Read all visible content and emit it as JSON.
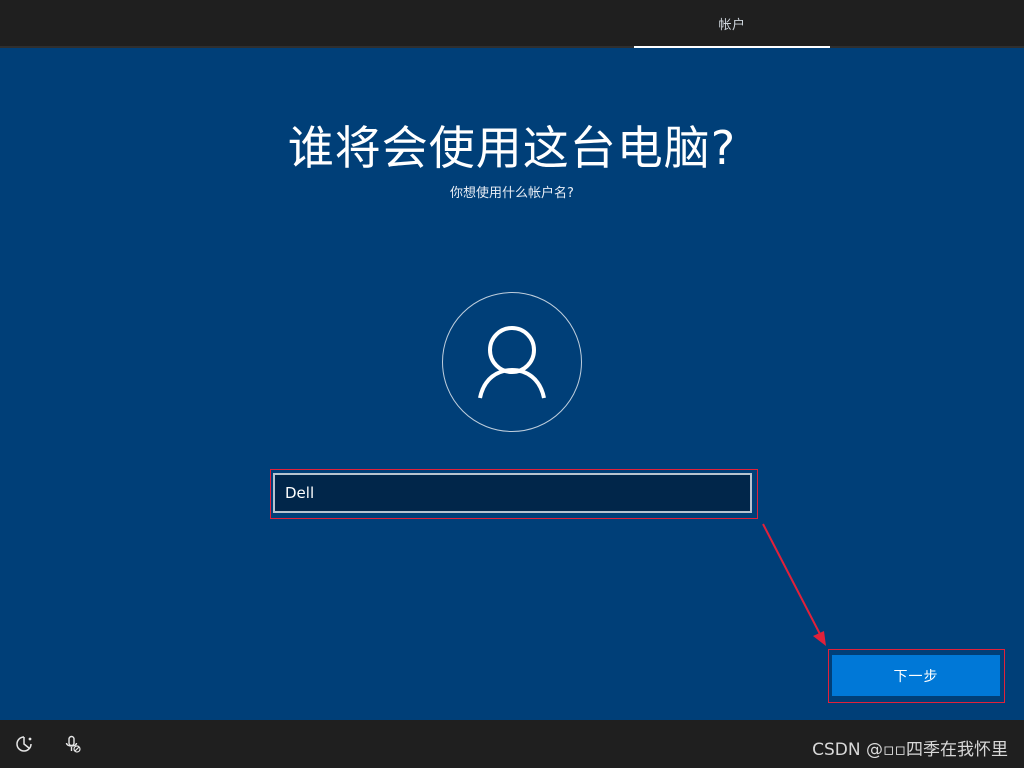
{
  "header": {
    "tab_label": "帐户"
  },
  "main": {
    "title": "谁将会使用这台电脑?",
    "subtitle": "你想使用什么帐户名?",
    "avatar_icon": "user-icon",
    "name_input": {
      "value": "Dell",
      "placeholder": ""
    },
    "next_button_label": "下一步"
  },
  "footer": {
    "left_icons": [
      "accessibility-icon",
      "microphone-icon"
    ],
    "watermark": "CSDN @▫▫四季在我怀里"
  },
  "colors": {
    "background": "#003f78",
    "topbar": "#1f1f1f",
    "bottombar": "#1f1f1f",
    "input_bg": "#01264a",
    "button_accent": "#0078d7",
    "highlight_red": "#e1213a"
  }
}
